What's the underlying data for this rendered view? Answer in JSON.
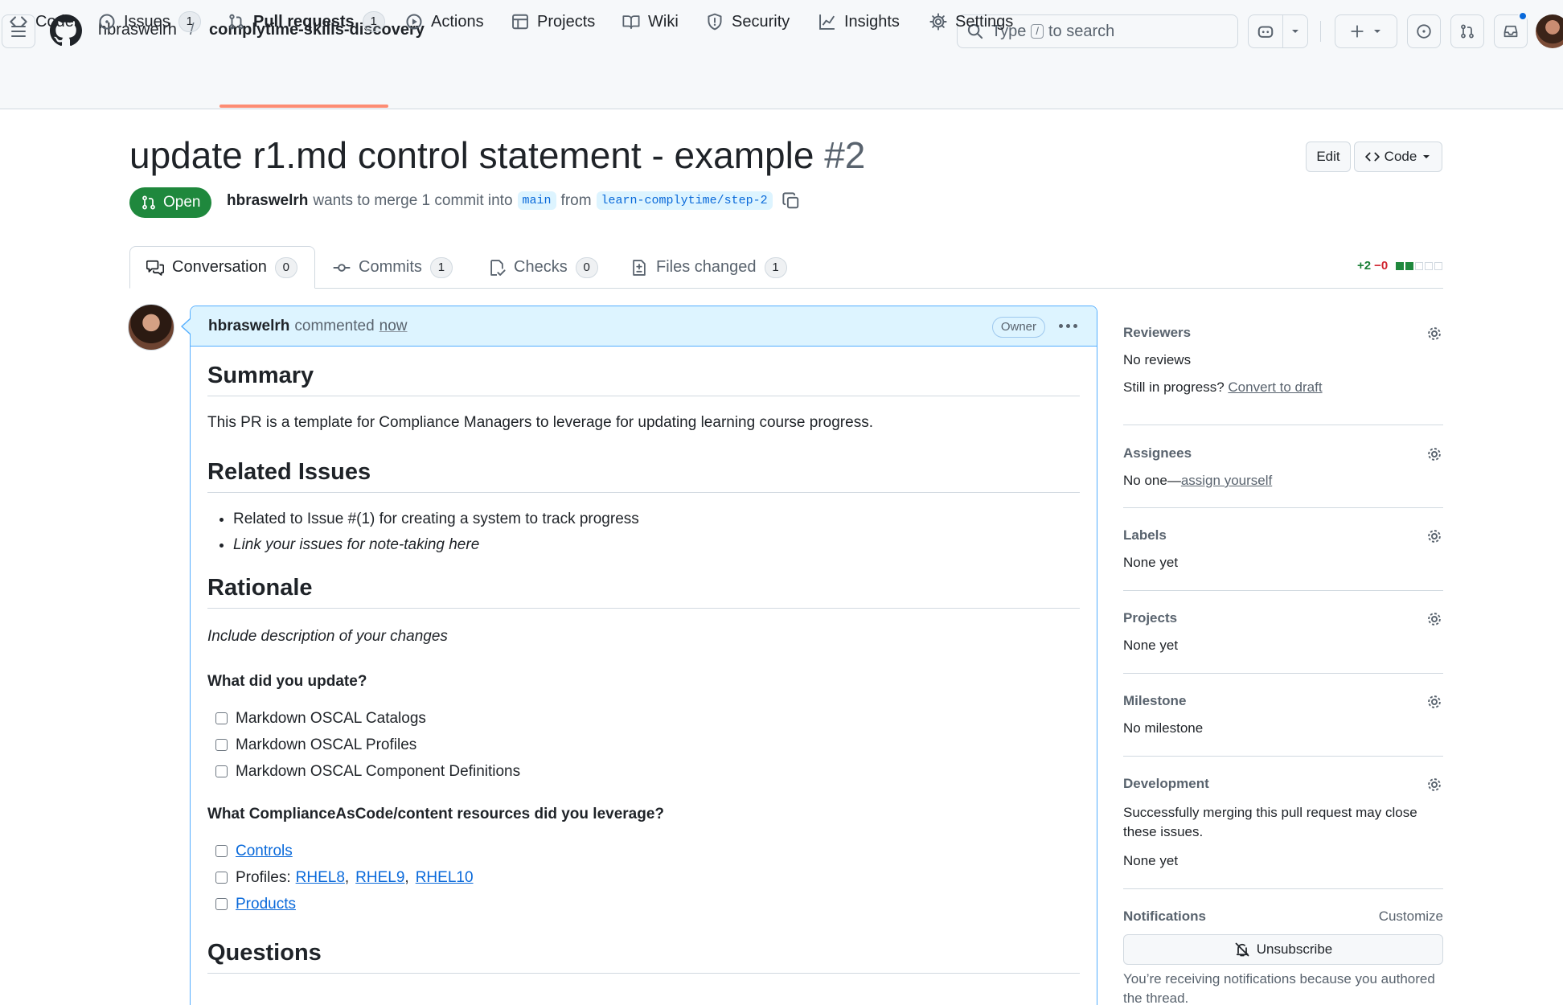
{
  "header": {
    "owner": "hbraswelrh",
    "separator": "/",
    "repo": "complytime-skills-discovery",
    "search_prefix": "Type",
    "search_key": "/",
    "search_suffix": "to search"
  },
  "repo_nav": [
    {
      "label": "Code",
      "icon": "code-icon"
    },
    {
      "label": "Issues",
      "icon": "issue-opened-icon",
      "count": "1"
    },
    {
      "label": "Pull requests",
      "icon": "git-pull-request-icon",
      "count": "1",
      "active": true
    },
    {
      "label": "Actions",
      "icon": "play-icon"
    },
    {
      "label": "Projects",
      "icon": "table-icon"
    },
    {
      "label": "Wiki",
      "icon": "book-icon"
    },
    {
      "label": "Security",
      "icon": "shield-icon"
    },
    {
      "label": "Insights",
      "icon": "graph-icon"
    },
    {
      "label": "Settings",
      "icon": "gear-icon"
    }
  ],
  "pr": {
    "title": "update r1.md control statement - example",
    "number": "#2",
    "edit_label": "Edit",
    "code_label": "Code",
    "state": "Open",
    "author": "hbraswelrh",
    "merge_text": "wants to merge 1 commit into",
    "base_branch": "main",
    "from_text": "from",
    "head_branch": "learn-complytime/step-2"
  },
  "tabs": [
    {
      "label": "Conversation",
      "count": "0",
      "icon": "comment-discussion-icon"
    },
    {
      "label": "Commits",
      "count": "1",
      "icon": "git-commit-icon"
    },
    {
      "label": "Checks",
      "count": "0",
      "icon": "checklist-icon"
    },
    {
      "label": "Files changed",
      "count": "1",
      "icon": "file-diff-icon"
    }
  ],
  "diffstat": {
    "additions": "+2",
    "deletions": "−0"
  },
  "comment": {
    "author": "hbraswelrh",
    "action": "commented",
    "when": "now",
    "badge": "Owner",
    "summary_heading": "Summary",
    "summary_text": "This PR is a template for Compliance Managers to leverage for updating learning course progress.",
    "related_heading": "Related Issues",
    "related_items": [
      "Related to Issue #(1) for creating a system to track progress",
      "Link your issues for note-taking here"
    ],
    "rationale_heading": "Rationale",
    "rationale_text": "Include description of your changes",
    "update_question": "What did you update?",
    "update_options": [
      "Markdown OSCAL Catalogs",
      "Markdown OSCAL Profiles",
      "Markdown OSCAL Component Definitions"
    ],
    "resources_question": "What ComplianceAsCode/content resources did you leverage?",
    "resources": {
      "controls": "Controls",
      "profiles_prefix": "Profiles:",
      "rhel8": "RHEL8",
      "rhel9": "RHEL9",
      "rhel10": "RHEL10",
      "products": "Products"
    },
    "questions_heading": "Questions"
  },
  "sidebar": {
    "reviewers": {
      "title": "Reviewers",
      "text": "No reviews",
      "draft_prefix": "Still in progress?",
      "draft_link": "Convert to draft"
    },
    "assignees": {
      "title": "Assignees",
      "prefix": "No one—",
      "link": "assign yourself"
    },
    "labels": {
      "title": "Labels",
      "text": "None yet"
    },
    "projects": {
      "title": "Projects",
      "text": "None yet"
    },
    "milestone": {
      "title": "Milestone",
      "text": "No milestone"
    },
    "development": {
      "title": "Development",
      "text": "Successfully merging this pull request may close these issues.",
      "value": "None yet"
    },
    "notifications": {
      "title": "Notifications",
      "customize": "Customize",
      "button": "Unsubscribe",
      "reason": "You’re receiving notifications because you authored the thread."
    }
  },
  "colors": {
    "accent": "#0969da",
    "open": "#1f883d",
    "nav_underline": "#fd8c73",
    "comment_header": "#ddf4ff"
  }
}
